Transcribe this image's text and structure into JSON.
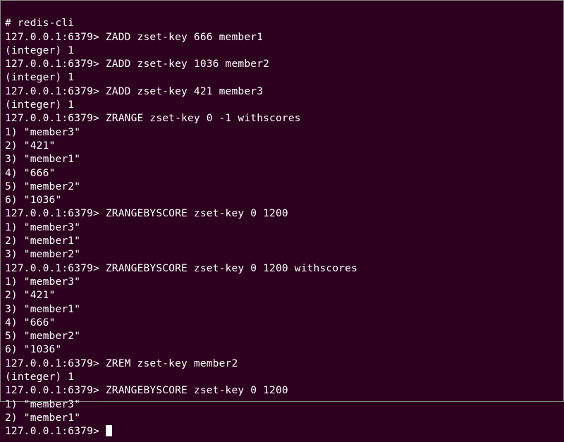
{
  "lines": [
    "# redis-cli",
    "127.0.0.1:6379> ZADD zset-key 666 member1",
    "(integer) 1",
    "127.0.0.1:6379> ZADD zset-key 1036 member2",
    "(integer) 1",
    "127.0.0.1:6379> ZADD zset-key 421 member3",
    "(integer) 1",
    "127.0.0.1:6379> ZRANGE zset-key 0 -1 withscores",
    "1) \"member3\"",
    "2) \"421\"",
    "3) \"member1\"",
    "4) \"666\"",
    "5) \"member2\"",
    "6) \"1036\"",
    "127.0.0.1:6379> ZRANGEBYSCORE zset-key 0 1200",
    "1) \"member3\"",
    "2) \"member1\"",
    "3) \"member2\"",
    "127.0.0.1:6379> ZRANGEBYSCORE zset-key 0 1200 withscores",
    "1) \"member3\"",
    "2) \"421\"",
    "3) \"member1\"",
    "4) \"666\"",
    "5) \"member2\"",
    "6) \"1036\"",
    "127.0.0.1:6379> ZREM zset-key member2",
    "(integer) 1",
    "127.0.0.1:6379> ZRANGEBYSCORE zset-key 0 1200",
    "1) \"member3\"",
    "2) \"member1\""
  ],
  "prompt_final": "127.0.0.1:6379> "
}
